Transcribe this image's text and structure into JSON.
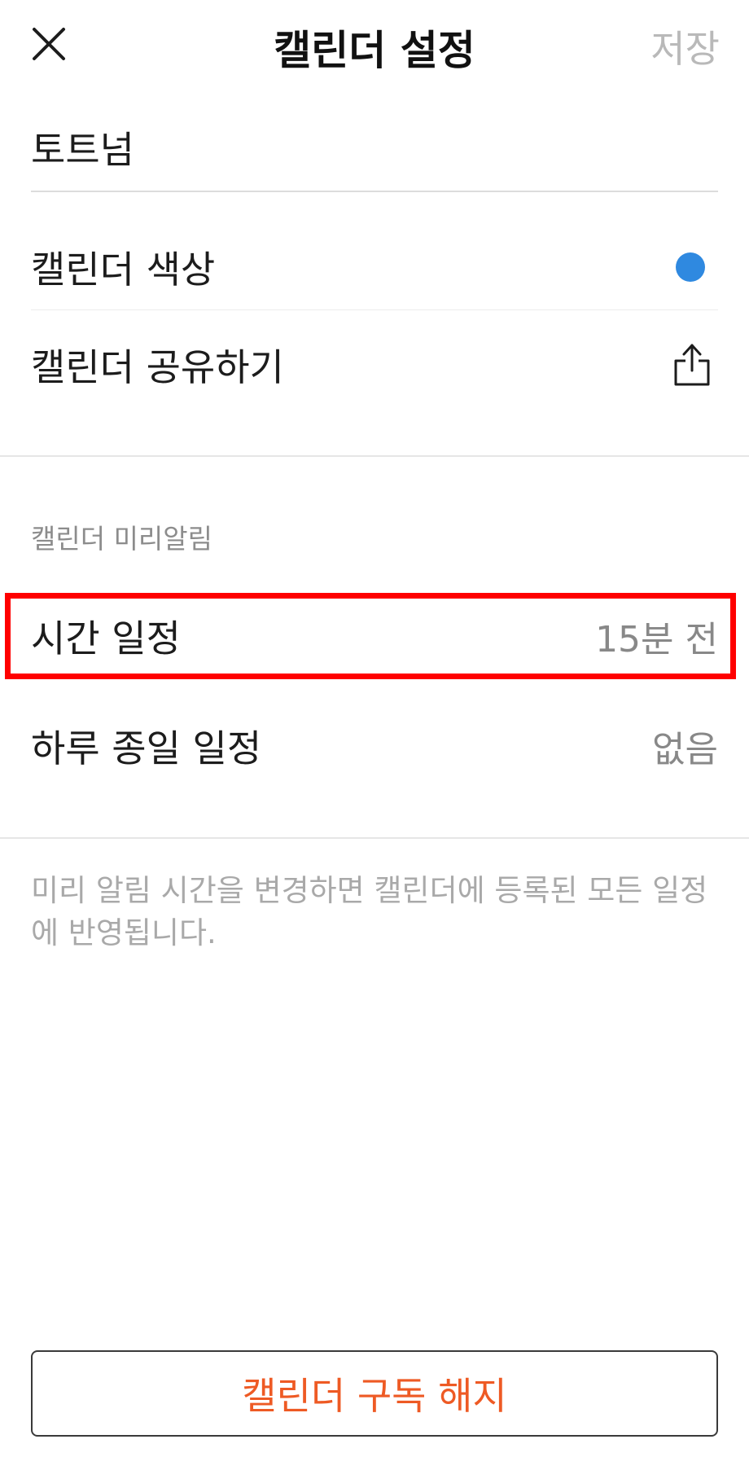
{
  "header": {
    "title": "캘린더 설정",
    "save_label": "저장",
    "close_icon": "close-icon"
  },
  "calendar": {
    "name": "토트넘",
    "color_label": "캘린더 색상",
    "color": "#2f89e0",
    "share_label": "캘린더 공유하기",
    "share_icon": "share-icon"
  },
  "reminders": {
    "section_title": "캘린더 미리알림",
    "timed_label": "시간 일정",
    "timed_value": "15분 전",
    "allday_label": "하루 종일 일정",
    "allday_value": "없음"
  },
  "note": "미리 알림 시간을 변경하면 캘린더에 등록된 모든 일정에 반영됩니다.",
  "unsubscribe_label": "캘린더 구독 해지",
  "colors": {
    "accent": "#ee5a24",
    "highlight": "#ff0000",
    "dot": "#2f89e0"
  }
}
